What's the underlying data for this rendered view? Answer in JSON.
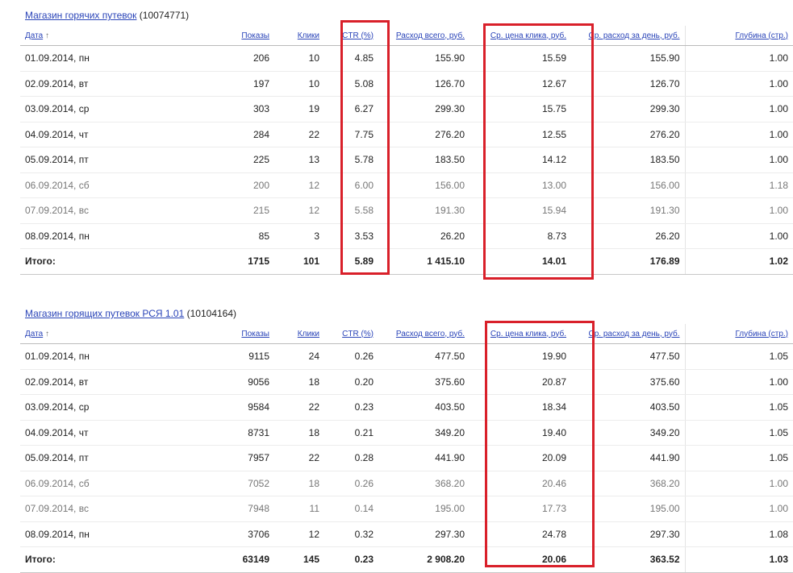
{
  "columns": [
    "Дата",
    "Показы",
    "Клики",
    "CTR (%)",
    "Расход всего, руб.",
    "Ср. цена клика, руб.",
    "Ср. расход за день, руб.",
    "Глубина (стр.)"
  ],
  "sort_arrow": "↑",
  "campaigns": [
    {
      "name": "Магазин горячих путевок",
      "id": "(10074771)",
      "rows": [
        {
          "date": "01.09.2014, пн",
          "shows": "206",
          "clicks": "10",
          "ctr": "4.85",
          "spend": "155.90",
          "cpc": "15.59",
          "daily": "155.90",
          "depth": "1.00",
          "weekend": false
        },
        {
          "date": "02.09.2014, вт",
          "shows": "197",
          "clicks": "10",
          "ctr": "5.08",
          "spend": "126.70",
          "cpc": "12.67",
          "daily": "126.70",
          "depth": "1.00",
          "weekend": false
        },
        {
          "date": "03.09.2014, ср",
          "shows": "303",
          "clicks": "19",
          "ctr": "6.27",
          "spend": "299.30",
          "cpc": "15.75",
          "daily": "299.30",
          "depth": "1.00",
          "weekend": false
        },
        {
          "date": "04.09.2014, чт",
          "shows": "284",
          "clicks": "22",
          "ctr": "7.75",
          "spend": "276.20",
          "cpc": "12.55",
          "daily": "276.20",
          "depth": "1.00",
          "weekend": false
        },
        {
          "date": "05.09.2014, пт",
          "shows": "225",
          "clicks": "13",
          "ctr": "5.78",
          "spend": "183.50",
          "cpc": "14.12",
          "daily": "183.50",
          "depth": "1.00",
          "weekend": false
        },
        {
          "date": "06.09.2014, сб",
          "shows": "200",
          "clicks": "12",
          "ctr": "6.00",
          "spend": "156.00",
          "cpc": "13.00",
          "daily": "156.00",
          "depth": "1.18",
          "weekend": true
        },
        {
          "date": "07.09.2014, вс",
          "shows": "215",
          "clicks": "12",
          "ctr": "5.58",
          "spend": "191.30",
          "cpc": "15.94",
          "daily": "191.30",
          "depth": "1.00",
          "weekend": true
        },
        {
          "date": "08.09.2014, пн",
          "shows": "85",
          "clicks": "3",
          "ctr": "3.53",
          "spend": "26.20",
          "cpc": "8.73",
          "daily": "26.20",
          "depth": "1.00",
          "weekend": false
        }
      ],
      "total": {
        "date": "Итого:",
        "shows": "1715",
        "clicks": "101",
        "ctr": "5.89",
        "spend": "1 415.10",
        "cpc": "14.01",
        "daily": "176.89",
        "depth": "1.02"
      }
    },
    {
      "name": "Магазин горящих путевок РСЯ 1.01",
      "id": "(10104164)",
      "rows": [
        {
          "date": "01.09.2014, пн",
          "shows": "9115",
          "clicks": "24",
          "ctr": "0.26",
          "spend": "477.50",
          "cpc": "19.90",
          "daily": "477.50",
          "depth": "1.05",
          "weekend": false
        },
        {
          "date": "02.09.2014, вт",
          "shows": "9056",
          "clicks": "18",
          "ctr": "0.20",
          "spend": "375.60",
          "cpc": "20.87",
          "daily": "375.60",
          "depth": "1.00",
          "weekend": false
        },
        {
          "date": "03.09.2014, ср",
          "shows": "9584",
          "clicks": "22",
          "ctr": "0.23",
          "spend": "403.50",
          "cpc": "18.34",
          "daily": "403.50",
          "depth": "1.05",
          "weekend": false
        },
        {
          "date": "04.09.2014, чт",
          "shows": "8731",
          "clicks": "18",
          "ctr": "0.21",
          "spend": "349.20",
          "cpc": "19.40",
          "daily": "349.20",
          "depth": "1.05",
          "weekend": false
        },
        {
          "date": "05.09.2014, пт",
          "shows": "7957",
          "clicks": "22",
          "ctr": "0.28",
          "spend": "441.90",
          "cpc": "20.09",
          "daily": "441.90",
          "depth": "1.05",
          "weekend": false
        },
        {
          "date": "06.09.2014, сб",
          "shows": "7052",
          "clicks": "18",
          "ctr": "0.26",
          "spend": "368.20",
          "cpc": "20.46",
          "daily": "368.20",
          "depth": "1.00",
          "weekend": true
        },
        {
          "date": "07.09.2014, вс",
          "shows": "7948",
          "clicks": "11",
          "ctr": "0.14",
          "spend": "195.00",
          "cpc": "17.73",
          "daily": "195.00",
          "depth": "1.00",
          "weekend": true
        },
        {
          "date": "08.09.2014, пн",
          "shows": "3706",
          "clicks": "12",
          "ctr": "0.32",
          "spend": "297.30",
          "cpc": "24.78",
          "daily": "297.30",
          "depth": "1.08",
          "weekend": false
        }
      ],
      "total": {
        "date": "Итого:",
        "shows": "63149",
        "clicks": "145",
        "ctr": "0.23",
        "spend": "2 908.20",
        "cpc": "20.06",
        "daily": "363.52",
        "depth": "1.03"
      }
    }
  ],
  "highlight_color": "#d9202a"
}
